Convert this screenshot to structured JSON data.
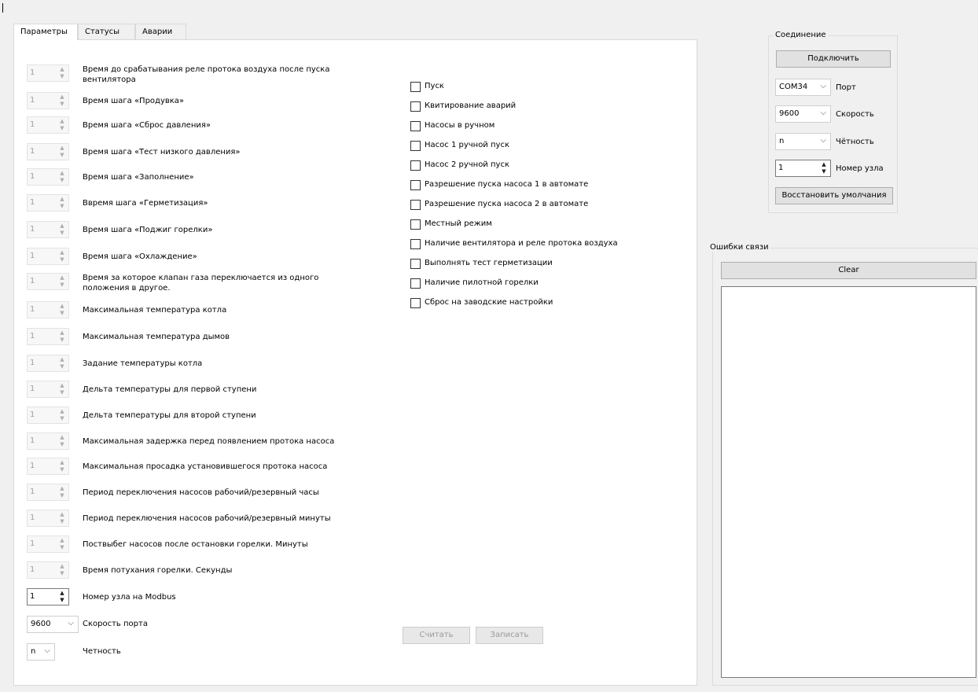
{
  "tabs": [
    {
      "label": "Параметры"
    },
    {
      "label": "Статусы"
    },
    {
      "label": "Аварии"
    }
  ],
  "params": [
    {
      "value": "1",
      "label": "Время до срабатывания реле протока воздуха после пуска вентилятора"
    },
    {
      "value": "1",
      "label": "Время шага «Продувка»"
    },
    {
      "value": "1",
      "label": "Время шага «Сброс давления»"
    },
    {
      "value": "1",
      "label": "Время шага «Тест низкого давления»"
    },
    {
      "value": "1",
      "label": "Время шага «Заполнение»"
    },
    {
      "value": "1",
      "label": "Ввремя шага «Герметизация»"
    },
    {
      "value": "1",
      "label": "Время шага «Поджиг горелки»"
    },
    {
      "value": "1",
      "label": "Время шага «Охлаждение»"
    },
    {
      "value": "1",
      "label": "Время за которое клапан газа переключается из одного положения в другое."
    },
    {
      "value": "1",
      "label": "Максимальная температура котла"
    },
    {
      "value": "1",
      "label": "Максимальная температура дымов"
    },
    {
      "value": "1",
      "label": "Задание температуры котла"
    },
    {
      "value": "1",
      "label": "Дельта температуры для первой ступени"
    },
    {
      "value": "1",
      "label": "Дельта температуры для второй ступени"
    },
    {
      "value": "1",
      "label": "Максимальная задержка перед появлением протока насоса"
    },
    {
      "value": "1",
      "label": "Максимальная просадка установившегося протока насоса"
    },
    {
      "value": "1",
      "label": "Период переключения насосов рабочий/резервный часы"
    },
    {
      "value": "1",
      "label": "Период переключения насосов рабочий/резервный минуты"
    },
    {
      "value": "1",
      "label": "Поствыбег насосов после остановки горелки. Минуты"
    },
    {
      "value": "1",
      "label": "Время потухания горелки. Секунды"
    }
  ],
  "modbus": {
    "value": "1",
    "label": "Номер узла на Modbus"
  },
  "port_speed": {
    "value": "9600",
    "label": "Скорость порта"
  },
  "parity": {
    "value": "n",
    "label": "Четность"
  },
  "checkboxes": [
    {
      "label": "Пуск",
      "checked": false
    },
    {
      "label": "Квитирование аварий",
      "checked": false
    },
    {
      "label": "Насосы в ручном",
      "checked": false
    },
    {
      "label": "Насос 1 ручной пуск",
      "checked": false
    },
    {
      "label": "Насос 2 ручной пуск",
      "checked": false
    },
    {
      "label": "Разрешение пуска насоса 1 в автомате",
      "checked": false
    },
    {
      "label": "Разрешение пуска насоса 2 в автомате",
      "checked": false
    },
    {
      "label": "Местный режим",
      "checked": false
    },
    {
      "label": "Наличие вентилятора и реле протока воздуха",
      "checked": false
    },
    {
      "label": "Выполнять тест герметизации",
      "checked": false
    },
    {
      "label": "Наличие пилотной горелки",
      "checked": false
    },
    {
      "label": "Сброс на заводские настройки",
      "checked": false
    }
  ],
  "actions": {
    "read": "Считать",
    "write": "Записать"
  },
  "connection": {
    "title": "Соединение",
    "connect": "Подключить",
    "port_value": "COM34",
    "port_label": "Порт",
    "speed_value": "9600",
    "speed_label": "Скорость",
    "parity_value": "n",
    "parity_label": "Чётность",
    "node_value": "1",
    "node_label": "Номер узла",
    "restore": "Восстановить умолчания"
  },
  "errors": {
    "title": "Ошибки связи",
    "clear": "Clear"
  }
}
